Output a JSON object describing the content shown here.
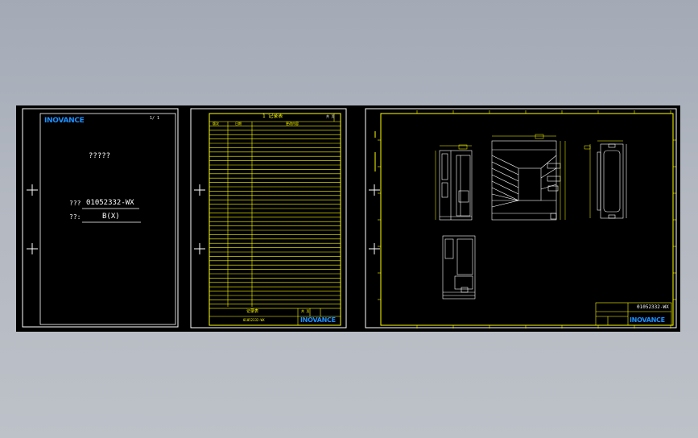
{
  "colors": {
    "background": "#000000",
    "border": "#ffffff",
    "frame": "#ffff00",
    "logo": "#1e90ff",
    "drawing": "#ffffff"
  },
  "sheet1": {
    "logo": "INOVANCE",
    "page_marks": "1/   1",
    "title": "?????",
    "code_label": "???",
    "code_value": "01052332-WX",
    "version_label": "??:",
    "version_value": "B(X)"
  },
  "sheet2": {
    "header_title": "1  记录表",
    "header_marks": "共    页",
    "col_labels": [
      "版次",
      "日期",
      "更改内容"
    ],
    "footer_center": "记录表",
    "footer_code": "01052332-WX",
    "footer_marks": "共    页",
    "logo": "INOVANCE"
  },
  "sheet3": {
    "title_code": "01052332-WX",
    "logo": "INOVANCE"
  }
}
